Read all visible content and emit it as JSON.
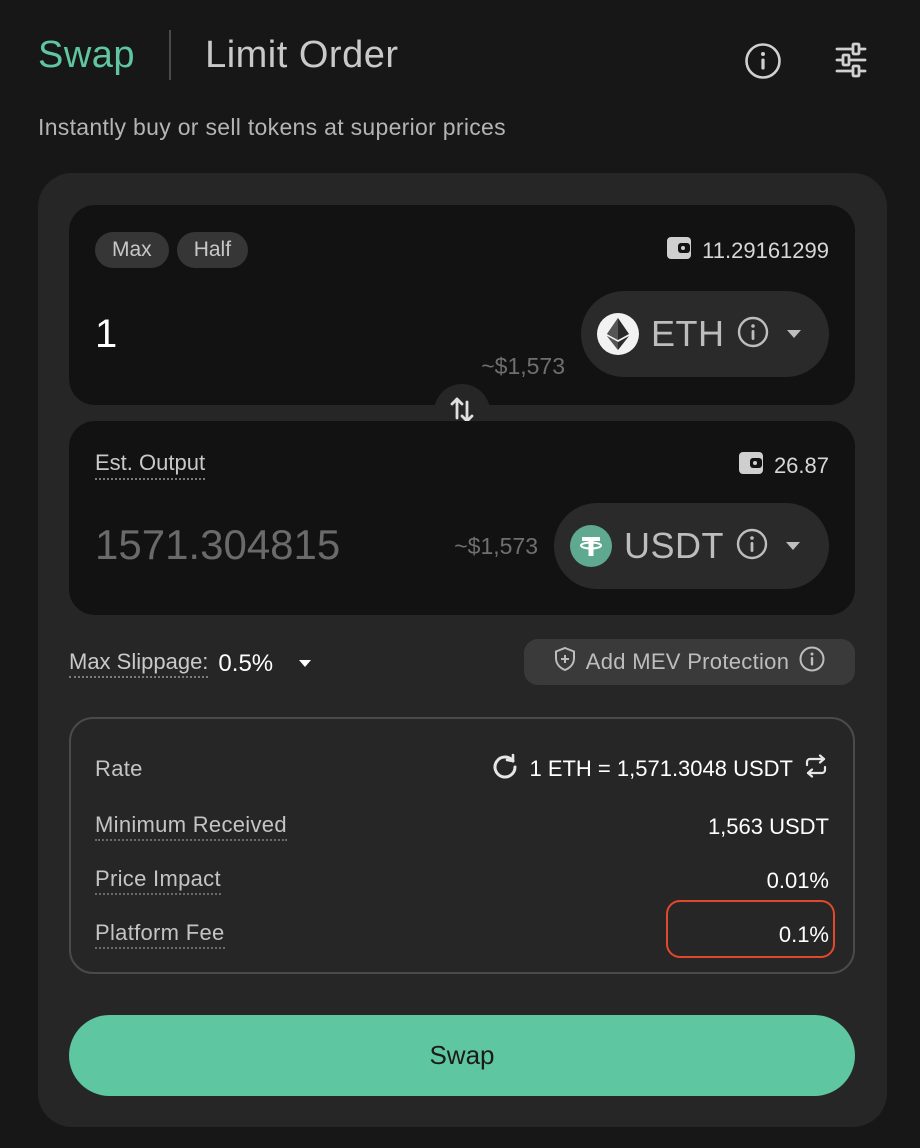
{
  "header": {
    "tab_swap": "Swap",
    "tab_limit": "Limit Order",
    "subtitle": "Instantly buy or sell tokens at superior prices"
  },
  "input_panel": {
    "max_label": "Max",
    "half_label": "Half",
    "balance": "11.29161299",
    "amount": "1",
    "usd_value": "~$1,573",
    "token_symbol": "ETH",
    "token_icon": "eth-logo"
  },
  "output_panel": {
    "label": "Est. Output",
    "balance": "26.87",
    "amount": "1571.304815",
    "usd_value": "~$1,573",
    "token_symbol": "USDT",
    "token_icon": "usdt-logo"
  },
  "slippage": {
    "label": "Max Slippage:",
    "value": "0.5%"
  },
  "mev": {
    "label": "Add MEV Protection"
  },
  "details": {
    "rate_label": "Rate",
    "rate_value": "1 ETH = 1,571.3048 USDT",
    "min_received_label": "Minimum Received",
    "min_received_value": "1,563 USDT",
    "price_impact_label": "Price Impact",
    "price_impact_value": "0.01%",
    "platform_fee_label": "Platform Fee",
    "platform_fee_value": "0.1%"
  },
  "swap_button_label": "Swap",
  "colors": {
    "accent": "#5ec6a0",
    "background": "#171717",
    "card": "#262626",
    "panel": "#121212",
    "highlight": "#e0492a"
  }
}
